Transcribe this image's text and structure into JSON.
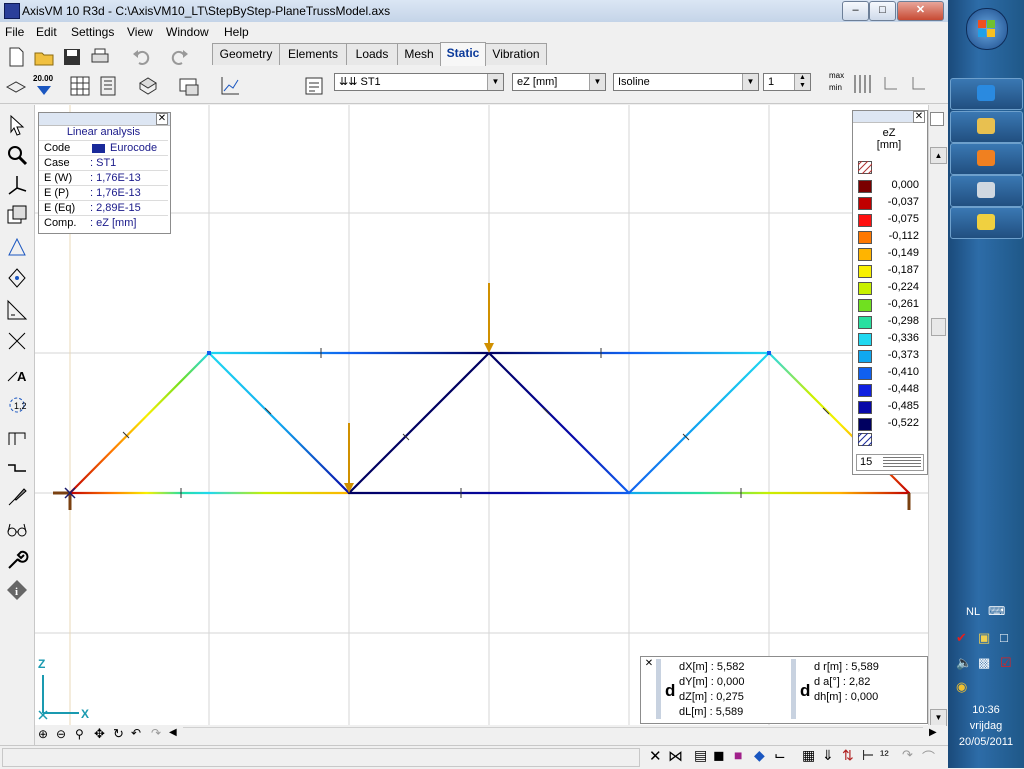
{
  "window": {
    "title": "AxisVM 10 R3d - C:\\AxisVM10_LT\\StepByStep-PlaneTrussModel.axs"
  },
  "menu": [
    {
      "id": "file",
      "label": "File"
    },
    {
      "id": "edit",
      "label": "Edit"
    },
    {
      "id": "settings",
      "label": "Settings"
    },
    {
      "id": "view",
      "label": "View"
    },
    {
      "id": "window",
      "label": "Window"
    },
    {
      "id": "help",
      "label": "Help"
    }
  ],
  "tabs": [
    {
      "id": "geometry",
      "label": "Geometry"
    },
    {
      "id": "elements",
      "label": "Elements"
    },
    {
      "id": "loads",
      "label": "Loads"
    },
    {
      "id": "mesh",
      "label": "Mesh"
    },
    {
      "id": "static",
      "label": "Static",
      "active": true
    },
    {
      "id": "vibration",
      "label": "Vibration"
    }
  ],
  "toolbar": {
    "load_case": "⇊⇊ ST1",
    "component": "eZ [mm]",
    "display_mode": "Isoline",
    "page": "1",
    "max_label": "max",
    "min_label": "min",
    "scale_label": "20.00"
  },
  "info_panel": {
    "title": "Linear analysis",
    "rows": [
      {
        "key": "Code",
        "value": "Eurocode"
      },
      {
        "key": "Case",
        "value": ": ST1"
      },
      {
        "key": "E (W)",
        "value": ": 1,76E-13"
      },
      {
        "key": "E (P)",
        "value": ": 1,76E-13"
      },
      {
        "key": "E (Eq)",
        "value": ": 2,89E-15"
      },
      {
        "key": "Comp.",
        "value": ": eZ [mm]"
      }
    ]
  },
  "legend": {
    "title": "eZ",
    "unit": "[mm]",
    "levels": [
      {
        "value": "0,000",
        "color": "#7a0000"
      },
      {
        "value": "-0,037",
        "color": "#c00000"
      },
      {
        "value": "-0,075",
        "color": "#ff1010"
      },
      {
        "value": "-0,112",
        "color": "#ff7800"
      },
      {
        "value": "-0,149",
        "color": "#ffb400"
      },
      {
        "value": "-0,187",
        "color": "#f8f000"
      },
      {
        "value": "-0,224",
        "color": "#c8f000"
      },
      {
        "value": "-0,261",
        "color": "#70e020"
      },
      {
        "value": "-0,298",
        "color": "#28e0a0"
      },
      {
        "value": "-0,336",
        "color": "#20d8f0"
      },
      {
        "value": "-0,373",
        "color": "#10a8f0"
      },
      {
        "value": "-0,410",
        "color": "#1060f0"
      },
      {
        "value": "-0,448",
        "color": "#1020e0"
      },
      {
        "value": "-0,485",
        "color": "#0808a8"
      },
      {
        "value": "-0,522",
        "color": "#000060"
      }
    ],
    "level_count": "15"
  },
  "measure": {
    "left": [
      {
        "label": "dX[m]",
        "value": ": 5,582"
      },
      {
        "label": "dY[m]",
        "value": ": 0,000"
      },
      {
        "label": "dZ[m]",
        "value": ": 0,275"
      },
      {
        "label": "dL[m]",
        "value": ": 5,589"
      }
    ],
    "right": [
      {
        "label": "d r[m]",
        "value": ": 5,589"
      },
      {
        "label": "d  a[°]",
        "value": ": 2,82"
      },
      {
        "label": "dh[m]",
        "value": ": 0,000"
      }
    ],
    "d_symbol": "d"
  },
  "axes": {
    "z": "Z",
    "x": "X"
  },
  "taskbar": {
    "lang": "NL",
    "time": "10:36",
    "day": "vrijdag",
    "date": "20/05/2011"
  },
  "colors": {
    "load_arrow": "#d09000",
    "support": "#7a4010",
    "grid": "#d6d6d6"
  }
}
